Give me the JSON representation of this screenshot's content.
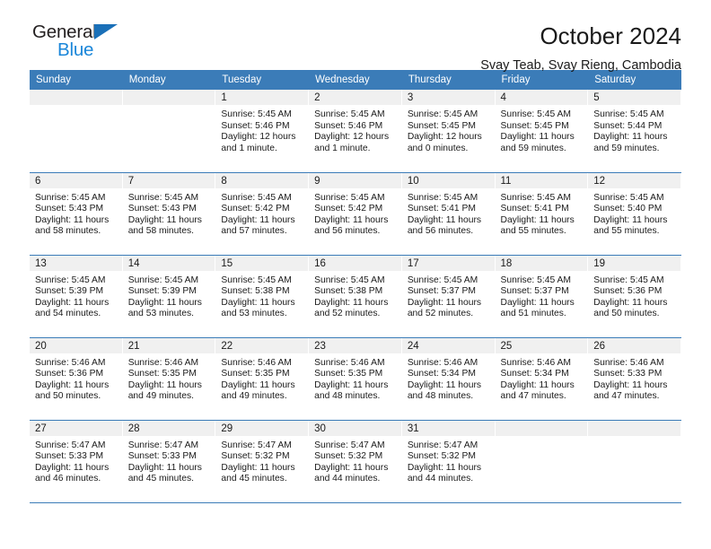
{
  "brand": {
    "name_top": "General",
    "name_bottom": "Blue",
    "triangle_color": "#1a70b8",
    "blue_text_color": "#1a86d9",
    "dark_text_color": "#231f20"
  },
  "header": {
    "title": "October 2024",
    "subtitle": "Svay Teab, Svay Rieng, Cambodia",
    "accent_color": "#3b7cb8",
    "datebar_color": "#f0f0f0"
  },
  "calendar": {
    "weekday_headers": [
      "Sunday",
      "Monday",
      "Tuesday",
      "Wednesday",
      "Thursday",
      "Friday",
      "Saturday"
    ],
    "weeks": [
      [
        {
          "date": "",
          "sunrise": "",
          "sunset": "",
          "daylight_line1": "",
          "daylight_line2": ""
        },
        {
          "date": "",
          "sunrise": "",
          "sunset": "",
          "daylight_line1": "",
          "daylight_line2": ""
        },
        {
          "date": "1",
          "sunrise": "Sunrise: 5:45 AM",
          "sunset": "Sunset: 5:46 PM",
          "daylight_line1": "Daylight: 12 hours",
          "daylight_line2": "and 1 minute."
        },
        {
          "date": "2",
          "sunrise": "Sunrise: 5:45 AM",
          "sunset": "Sunset: 5:46 PM",
          "daylight_line1": "Daylight: 12 hours",
          "daylight_line2": "and 1 minute."
        },
        {
          "date": "3",
          "sunrise": "Sunrise: 5:45 AM",
          "sunset": "Sunset: 5:45 PM",
          "daylight_line1": "Daylight: 12 hours",
          "daylight_line2": "and 0 minutes."
        },
        {
          "date": "4",
          "sunrise": "Sunrise: 5:45 AM",
          "sunset": "Sunset: 5:45 PM",
          "daylight_line1": "Daylight: 11 hours",
          "daylight_line2": "and 59 minutes."
        },
        {
          "date": "5",
          "sunrise": "Sunrise: 5:45 AM",
          "sunset": "Sunset: 5:44 PM",
          "daylight_line1": "Daylight: 11 hours",
          "daylight_line2": "and 59 minutes."
        }
      ],
      [
        {
          "date": "6",
          "sunrise": "Sunrise: 5:45 AM",
          "sunset": "Sunset: 5:43 PM",
          "daylight_line1": "Daylight: 11 hours",
          "daylight_line2": "and 58 minutes."
        },
        {
          "date": "7",
          "sunrise": "Sunrise: 5:45 AM",
          "sunset": "Sunset: 5:43 PM",
          "daylight_line1": "Daylight: 11 hours",
          "daylight_line2": "and 58 minutes."
        },
        {
          "date": "8",
          "sunrise": "Sunrise: 5:45 AM",
          "sunset": "Sunset: 5:42 PM",
          "daylight_line1": "Daylight: 11 hours",
          "daylight_line2": "and 57 minutes."
        },
        {
          "date": "9",
          "sunrise": "Sunrise: 5:45 AM",
          "sunset": "Sunset: 5:42 PM",
          "daylight_line1": "Daylight: 11 hours",
          "daylight_line2": "and 56 minutes."
        },
        {
          "date": "10",
          "sunrise": "Sunrise: 5:45 AM",
          "sunset": "Sunset: 5:41 PM",
          "daylight_line1": "Daylight: 11 hours",
          "daylight_line2": "and 56 minutes."
        },
        {
          "date": "11",
          "sunrise": "Sunrise: 5:45 AM",
          "sunset": "Sunset: 5:41 PM",
          "daylight_line1": "Daylight: 11 hours",
          "daylight_line2": "and 55 minutes."
        },
        {
          "date": "12",
          "sunrise": "Sunrise: 5:45 AM",
          "sunset": "Sunset: 5:40 PM",
          "daylight_line1": "Daylight: 11 hours",
          "daylight_line2": "and 55 minutes."
        }
      ],
      [
        {
          "date": "13",
          "sunrise": "Sunrise: 5:45 AM",
          "sunset": "Sunset: 5:39 PM",
          "daylight_line1": "Daylight: 11 hours",
          "daylight_line2": "and 54 minutes."
        },
        {
          "date": "14",
          "sunrise": "Sunrise: 5:45 AM",
          "sunset": "Sunset: 5:39 PM",
          "daylight_line1": "Daylight: 11 hours",
          "daylight_line2": "and 53 minutes."
        },
        {
          "date": "15",
          "sunrise": "Sunrise: 5:45 AM",
          "sunset": "Sunset: 5:38 PM",
          "daylight_line1": "Daylight: 11 hours",
          "daylight_line2": "and 53 minutes."
        },
        {
          "date": "16",
          "sunrise": "Sunrise: 5:45 AM",
          "sunset": "Sunset: 5:38 PM",
          "daylight_line1": "Daylight: 11 hours",
          "daylight_line2": "and 52 minutes."
        },
        {
          "date": "17",
          "sunrise": "Sunrise: 5:45 AM",
          "sunset": "Sunset: 5:37 PM",
          "daylight_line1": "Daylight: 11 hours",
          "daylight_line2": "and 52 minutes."
        },
        {
          "date": "18",
          "sunrise": "Sunrise: 5:45 AM",
          "sunset": "Sunset: 5:37 PM",
          "daylight_line1": "Daylight: 11 hours",
          "daylight_line2": "and 51 minutes."
        },
        {
          "date": "19",
          "sunrise": "Sunrise: 5:45 AM",
          "sunset": "Sunset: 5:36 PM",
          "daylight_line1": "Daylight: 11 hours",
          "daylight_line2": "and 50 minutes."
        }
      ],
      [
        {
          "date": "20",
          "sunrise": "Sunrise: 5:46 AM",
          "sunset": "Sunset: 5:36 PM",
          "daylight_line1": "Daylight: 11 hours",
          "daylight_line2": "and 50 minutes."
        },
        {
          "date": "21",
          "sunrise": "Sunrise: 5:46 AM",
          "sunset": "Sunset: 5:35 PM",
          "daylight_line1": "Daylight: 11 hours",
          "daylight_line2": "and 49 minutes."
        },
        {
          "date": "22",
          "sunrise": "Sunrise: 5:46 AM",
          "sunset": "Sunset: 5:35 PM",
          "daylight_line1": "Daylight: 11 hours",
          "daylight_line2": "and 49 minutes."
        },
        {
          "date": "23",
          "sunrise": "Sunrise: 5:46 AM",
          "sunset": "Sunset: 5:35 PM",
          "daylight_line1": "Daylight: 11 hours",
          "daylight_line2": "and 48 minutes."
        },
        {
          "date": "24",
          "sunrise": "Sunrise: 5:46 AM",
          "sunset": "Sunset: 5:34 PM",
          "daylight_line1": "Daylight: 11 hours",
          "daylight_line2": "and 48 minutes."
        },
        {
          "date": "25",
          "sunrise": "Sunrise: 5:46 AM",
          "sunset": "Sunset: 5:34 PM",
          "daylight_line1": "Daylight: 11 hours",
          "daylight_line2": "and 47 minutes."
        },
        {
          "date": "26",
          "sunrise": "Sunrise: 5:46 AM",
          "sunset": "Sunset: 5:33 PM",
          "daylight_line1": "Daylight: 11 hours",
          "daylight_line2": "and 47 minutes."
        }
      ],
      [
        {
          "date": "27",
          "sunrise": "Sunrise: 5:47 AM",
          "sunset": "Sunset: 5:33 PM",
          "daylight_line1": "Daylight: 11 hours",
          "daylight_line2": "and 46 minutes."
        },
        {
          "date": "28",
          "sunrise": "Sunrise: 5:47 AM",
          "sunset": "Sunset: 5:33 PM",
          "daylight_line1": "Daylight: 11 hours",
          "daylight_line2": "and 45 minutes."
        },
        {
          "date": "29",
          "sunrise": "Sunrise: 5:47 AM",
          "sunset": "Sunset: 5:32 PM",
          "daylight_line1": "Daylight: 11 hours",
          "daylight_line2": "and 45 minutes."
        },
        {
          "date": "30",
          "sunrise": "Sunrise: 5:47 AM",
          "sunset": "Sunset: 5:32 PM",
          "daylight_line1": "Daylight: 11 hours",
          "daylight_line2": "and 44 minutes."
        },
        {
          "date": "31",
          "sunrise": "Sunrise: 5:47 AM",
          "sunset": "Sunset: 5:32 PM",
          "daylight_line1": "Daylight: 11 hours",
          "daylight_line2": "and 44 minutes."
        },
        {
          "date": "",
          "sunrise": "",
          "sunset": "",
          "daylight_line1": "",
          "daylight_line2": ""
        },
        {
          "date": "",
          "sunrise": "",
          "sunset": "",
          "daylight_line1": "",
          "daylight_line2": ""
        }
      ]
    ]
  }
}
